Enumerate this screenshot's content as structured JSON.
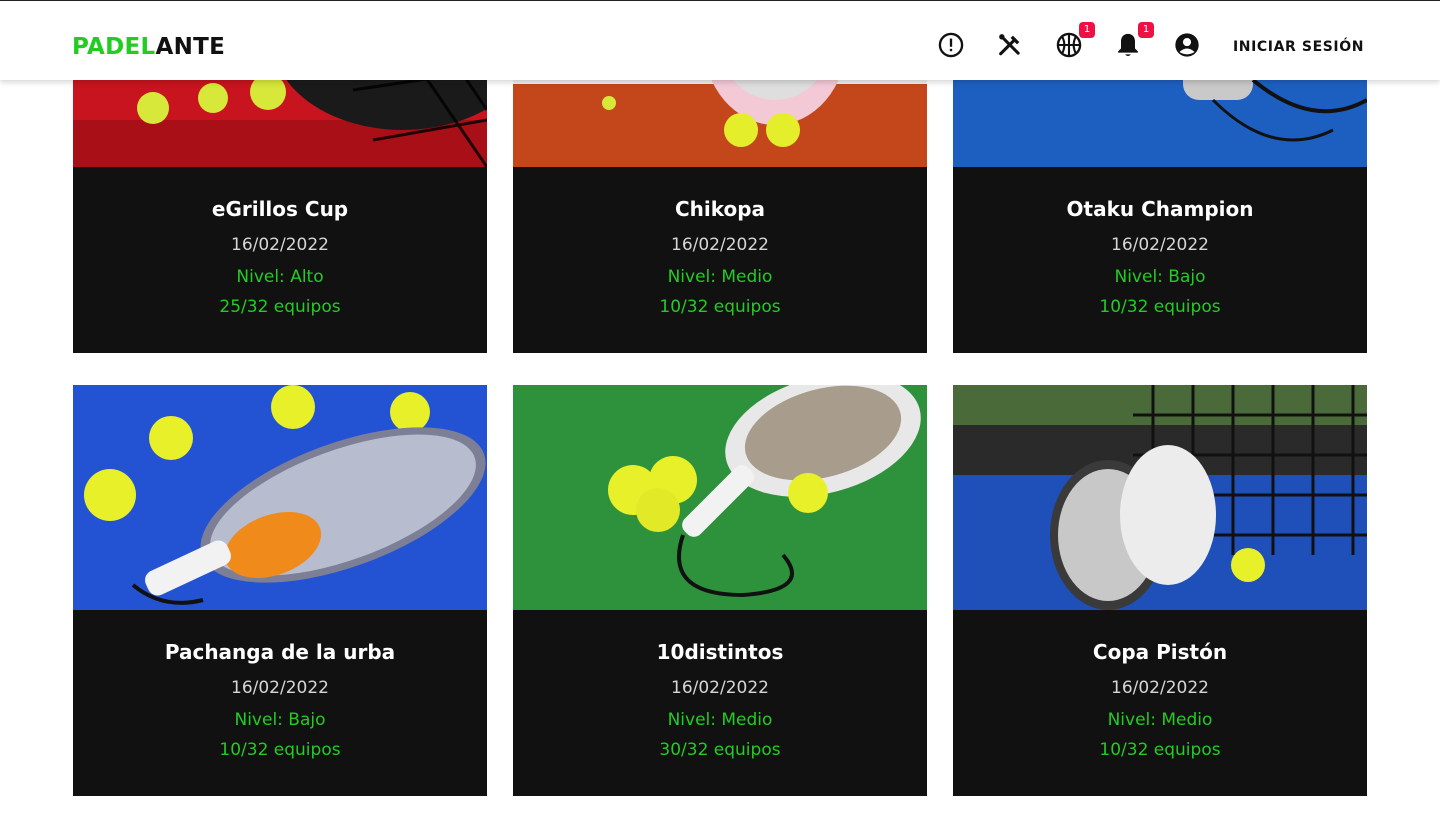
{
  "header": {
    "logo_part1": "PADEL",
    "logo_part2": "ANTE",
    "icons": [
      "alert-icon",
      "tools-icon",
      "ball-icon",
      "bell-icon",
      "account-icon"
    ],
    "ball_badge": "1",
    "bell_badge": "1",
    "login_label": "INICIAR SESIÓN"
  },
  "colors": {
    "accent": "#22cc22",
    "card_bg": "#111111",
    "badge": "#ee1144"
  },
  "tournaments": [
    {
      "name": "eGrillos Cup",
      "date": "16/02/2022",
      "level": "Nivel: Alto",
      "teams": "25/32 equipos"
    },
    {
      "name": "Chikopa",
      "date": "16/02/2022",
      "level": "Nivel: Medio",
      "teams": "10/32 equipos"
    },
    {
      "name": "Otaku Champion",
      "date": "16/02/2022",
      "level": "Nivel: Bajo",
      "teams": "10/32 equipos"
    },
    {
      "name": "Pachanga de la urba",
      "date": "16/02/2022",
      "level": "Nivel: Bajo",
      "teams": "10/32 equipos"
    },
    {
      "name": "10distintos",
      "date": "16/02/2022",
      "level": "Nivel: Medio",
      "teams": "30/32 equipos"
    },
    {
      "name": "Copa Pistón",
      "date": "16/02/2022",
      "level": "Nivel: Medio",
      "teams": "10/32 equipos"
    }
  ]
}
